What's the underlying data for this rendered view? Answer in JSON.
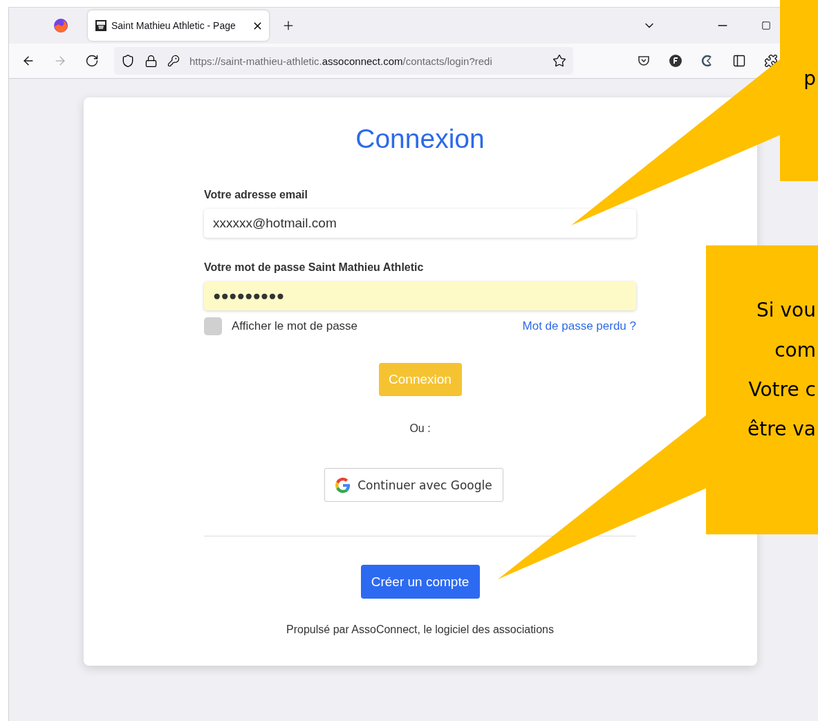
{
  "browser": {
    "tab": {
      "title": "Saint Mathieu Athletic - Page",
      "selected": true
    },
    "address_bar": {
      "url_prefix": "https://saint-mathieu-athletic.",
      "url_domain": "assoconnect.com",
      "url_path": "/contacts/login?redi"
    }
  },
  "login": {
    "title": "Connexion",
    "email": {
      "label": "Votre adresse email",
      "value": "xxxxxx@hotmail.com"
    },
    "password": {
      "label": "Votre mot de passe Saint Mathieu Athletic",
      "value": "●●●●●●●●●"
    },
    "show_password": {
      "label": "Afficher le mot de passe",
      "checked": false
    },
    "forgot_link": "Mot de passe perdu ?",
    "submit": "Connexion",
    "separator": "Ou :",
    "google": "Continuer avec Google",
    "create_account": "Créer un compte",
    "footer": "Propulsé par AssoConnect, le logiciel des associations"
  },
  "callouts": [
    {
      "lines": [
        "p"
      ]
    },
    {
      "lines": [
        "Si vou",
        "com",
        "Votre c",
        "être va"
      ]
    }
  ]
}
